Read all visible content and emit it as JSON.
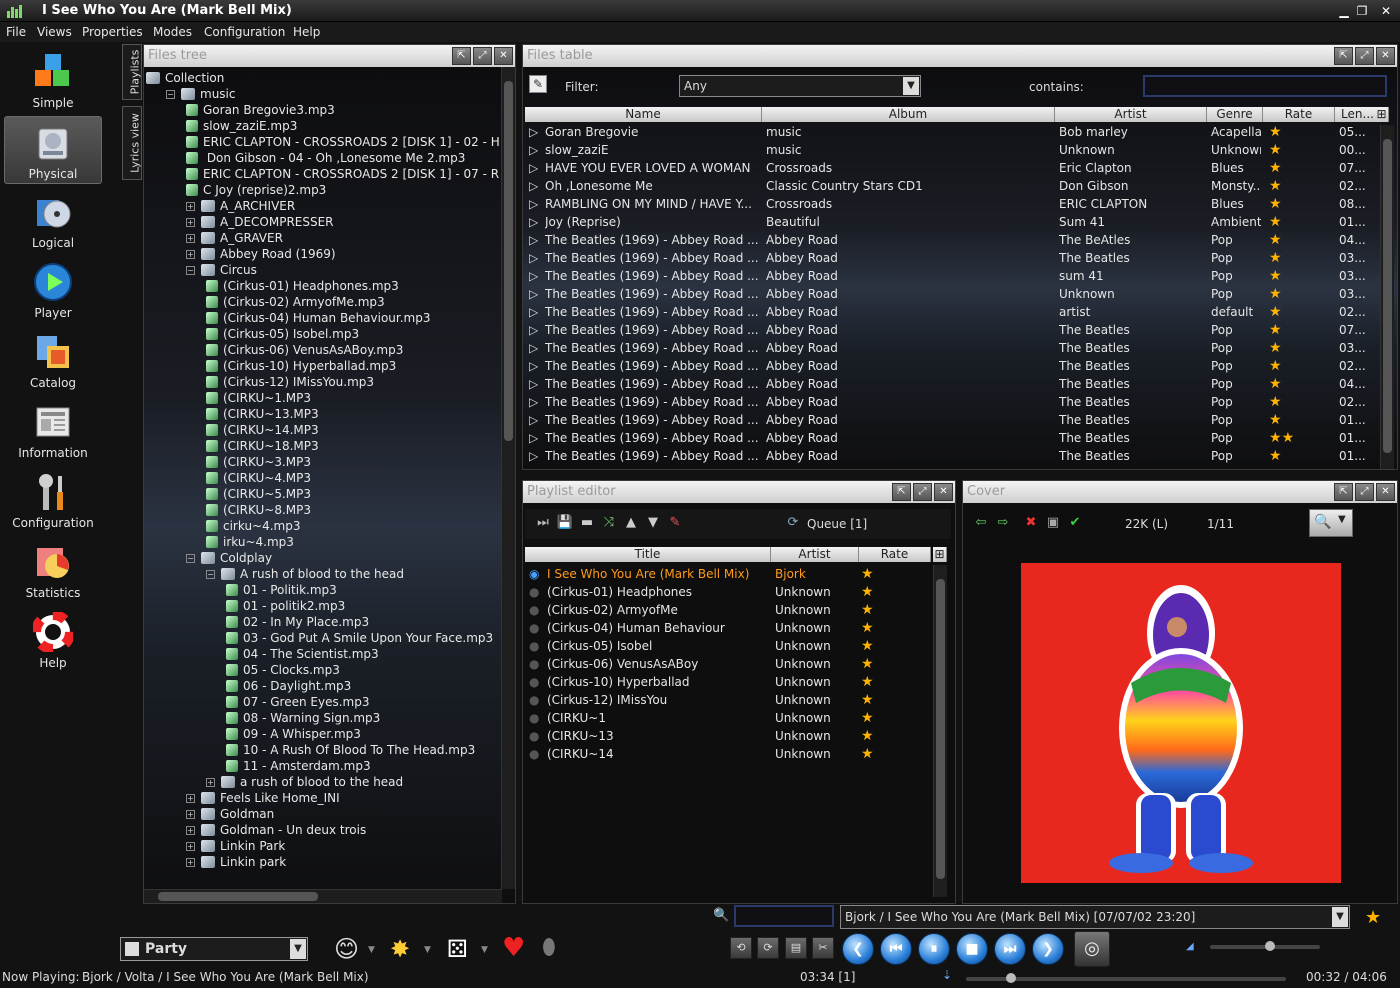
{
  "window": {
    "title": "I See Who You Are (Mark Bell Mix)"
  },
  "menu": [
    "File",
    "Views",
    "Properties",
    "Modes",
    "Configuration",
    "Help"
  ],
  "perspectives": [
    {
      "label": "Simple",
      "icon": "cubes-icon"
    },
    {
      "label": "Physical",
      "icon": "harddisk-icon",
      "selected": true
    },
    {
      "label": "Logical",
      "icon": "cd-icon"
    },
    {
      "label": "Player",
      "icon": "play-icon"
    },
    {
      "label": "Catalog",
      "icon": "catalog-icon"
    },
    {
      "label": "Information",
      "icon": "newspaper-icon"
    },
    {
      "label": "Configuration",
      "icon": "tools-icon"
    },
    {
      "label": "Statistics",
      "icon": "statistics-icon"
    },
    {
      "label": "Help",
      "icon": "lifebuoy-icon"
    }
  ],
  "side_tabs": [
    "Playlists",
    "Lyrics view"
  ],
  "files_tree": {
    "title": "Files tree",
    "items": [
      {
        "label": "Collection",
        "level": 0,
        "type": "root"
      },
      {
        "label": "music",
        "level": 1,
        "type": "folder",
        "expanded": true
      },
      {
        "label": "Goran Bregovie3.mp3",
        "level": 2,
        "type": "file"
      },
      {
        "label": "slow_zaziE.mp3",
        "level": 2,
        "type": "file"
      },
      {
        "label": "ERIC CLAPTON - CROSSROADS 2 [DISK 1] - 02 - H",
        "level": 2,
        "type": "file"
      },
      {
        "label": " Don Gibson - 04 - Oh ,Lonesome Me 2.mp3",
        "level": 2,
        "type": "file"
      },
      {
        "label": "ERIC CLAPTON - CROSSROADS 2 [DISK 1] - 07 - R",
        "level": 2,
        "type": "file"
      },
      {
        "label": "C Joy (reprise)2.mp3",
        "level": 2,
        "type": "file"
      },
      {
        "label": "A_ARCHIVER",
        "level": 2,
        "type": "folder"
      },
      {
        "label": "A_DECOMPRESSER",
        "level": 2,
        "type": "folder"
      },
      {
        "label": "A_GRAVER",
        "level": 2,
        "type": "folder"
      },
      {
        "label": "Abbey Road (1969)",
        "level": 2,
        "type": "folder",
        "collapsed": true
      },
      {
        "label": "Circus",
        "level": 2,
        "type": "folder",
        "expanded": true
      },
      {
        "label": "(Cirkus-01) Headphones.mp3",
        "level": 3,
        "type": "file"
      },
      {
        "label": "(Cirkus-02) ArmyofMe.mp3",
        "level": 3,
        "type": "file"
      },
      {
        "label": "(Cirkus-04) Human Behaviour.mp3",
        "level": 3,
        "type": "file"
      },
      {
        "label": "(Cirkus-05) Isobel.mp3",
        "level": 3,
        "type": "file"
      },
      {
        "label": "(Cirkus-06) VenusAsABoy.mp3",
        "level": 3,
        "type": "file"
      },
      {
        "label": "(Cirkus-10) Hyperballad.mp3",
        "level": 3,
        "type": "file"
      },
      {
        "label": "(Cirkus-12) IMissYou.mp3",
        "level": 3,
        "type": "file"
      },
      {
        "label": "(CIRKU~1.MP3",
        "level": 3,
        "type": "file"
      },
      {
        "label": "(CIRKU~13.MP3",
        "level": 3,
        "type": "file"
      },
      {
        "label": "(CIRKU~14.MP3",
        "level": 3,
        "type": "file"
      },
      {
        "label": "(CIRKU~18.MP3",
        "level": 3,
        "type": "file"
      },
      {
        "label": "(CIRKU~3.MP3",
        "level": 3,
        "type": "file"
      },
      {
        "label": "(CIRKU~4.MP3",
        "level": 3,
        "type": "file"
      },
      {
        "label": "(CIRKU~5.MP3",
        "level": 3,
        "type": "file"
      },
      {
        "label": "(CIRKU~8.MP3",
        "level": 3,
        "type": "file"
      },
      {
        "label": "cirku~4.mp3",
        "level": 3,
        "type": "file"
      },
      {
        "label": "irku~4.mp3",
        "level": 3,
        "type": "file"
      },
      {
        "label": "Coldplay",
        "level": 2,
        "type": "folder",
        "expanded": true
      },
      {
        "label": "A rush of blood to the head",
        "level": 3,
        "type": "folder",
        "expanded": true
      },
      {
        "label": "01 - Politik.mp3",
        "level": 4,
        "type": "file"
      },
      {
        "label": "01 - politik2.mp3",
        "level": 4,
        "type": "file"
      },
      {
        "label": "02 - In My Place.mp3",
        "level": 4,
        "type": "file"
      },
      {
        "label": "03 - God Put A Smile Upon Your Face.mp3",
        "level": 4,
        "type": "file"
      },
      {
        "label": "04 - The Scientist.mp3",
        "level": 4,
        "type": "file"
      },
      {
        "label": "05 - Clocks.mp3",
        "level": 4,
        "type": "file"
      },
      {
        "label": "06 - Daylight.mp3",
        "level": 4,
        "type": "file"
      },
      {
        "label": "07 - Green Eyes.mp3",
        "level": 4,
        "type": "file"
      },
      {
        "label": "08 - Warning Sign.mp3",
        "level": 4,
        "type": "file"
      },
      {
        "label": "09 - A Whisper.mp3",
        "level": 4,
        "type": "file"
      },
      {
        "label": "10 - A Rush Of Blood To The Head.mp3",
        "level": 4,
        "type": "file"
      },
      {
        "label": "11 - Amsterdam.mp3",
        "level": 4,
        "type": "file"
      },
      {
        "label": "a rush of blood to the head",
        "level": 3,
        "type": "folder",
        "collapsed": true
      },
      {
        "label": "Feels Like Home_INI",
        "level": 2,
        "type": "folder",
        "collapsed": true
      },
      {
        "label": "Goldman",
        "level": 2,
        "type": "folder",
        "collapsed": true
      },
      {
        "label": "Goldman - Un deux trois",
        "level": 2,
        "type": "folder",
        "collapsed": true
      },
      {
        "label": "Linkin Park",
        "level": 2,
        "type": "folder",
        "collapsed": true
      },
      {
        "label": "Linkin park",
        "level": 2,
        "type": "folder",
        "collapsed": true
      }
    ]
  },
  "files_table": {
    "title": "Files table",
    "filter_label": "Filter:",
    "filter_value": "Any",
    "contains_label": "contains:",
    "contains_value": "",
    "columns": [
      "Name",
      "Album",
      "Artist",
      "Genre",
      "Rate",
      "Len..."
    ],
    "rows": [
      [
        "Goran Bregovie",
        "music",
        "Bob marley",
        "Acapella",
        "1",
        "05..."
      ],
      [
        "slow_zaziE",
        "music",
        "Unknown",
        "Unknown",
        "1",
        "00..."
      ],
      [
        "HAVE YOU EVER LOVED A WOMAN",
        "Crossroads",
        "Eric Clapton",
        "Blues",
        "1",
        "07..."
      ],
      [
        "Oh ,Lonesome Me",
        "Classic Country Stars CD1",
        "Don Gibson",
        "Monsty...",
        "1",
        "02..."
      ],
      [
        "RAMBLING ON MY MIND / HAVE Y...",
        "Crossroads",
        "ERIC CLAPTON",
        "Blues",
        "1",
        "08..."
      ],
      [
        "Joy (Reprise)",
        "Beautiful",
        "Sum 41",
        "Ambient",
        "1",
        "01..."
      ],
      [
        "The Beatles (1969) - Abbey Road ...",
        "Abbey Road",
        "The BeAtles",
        "Pop",
        "1",
        "04..."
      ],
      [
        "The Beatles (1969) - Abbey Road ...",
        "Abbey Road",
        "The  Beatles",
        "Pop",
        "1",
        "03..."
      ],
      [
        "The Beatles (1969) - Abbey Road ...",
        "Abbey Road",
        "sum 41",
        "Pop",
        "1",
        "03..."
      ],
      [
        "The Beatles (1969) - Abbey Road ...",
        "Abbey Road",
        "Unknown",
        "Pop",
        "1",
        "03..."
      ],
      [
        "The Beatles (1969) - Abbey Road ...",
        "Abbey Road",
        "artist",
        "default",
        "1",
        "02..."
      ],
      [
        "The Beatles (1969) - Abbey Road ...",
        "Abbey Road",
        "The Beatles",
        "Pop",
        "1",
        "07..."
      ],
      [
        "The Beatles (1969) - Abbey Road ...",
        "Abbey Road",
        "The Beatles",
        "Pop",
        "1",
        "03..."
      ],
      [
        "The Beatles (1969) - Abbey Road ...",
        "Abbey Road",
        "The Beatles",
        "Pop",
        "1",
        "02..."
      ],
      [
        "The Beatles (1969) - Abbey Road ...",
        "Abbey Road",
        "The Beatles",
        "Pop",
        "1",
        "04..."
      ],
      [
        "The Beatles (1969) - Abbey Road ...",
        "Abbey Road",
        "The Beatles",
        "Pop",
        "1",
        "02..."
      ],
      [
        "The Beatles (1969) - Abbey Road ...",
        "Abbey Road",
        "The Beatles",
        "Pop",
        "1",
        "01..."
      ],
      [
        "The Beatles (1969) - Abbey Road ...",
        "Abbey Road",
        "The Beatles",
        "Pop",
        "2",
        "01..."
      ],
      [
        "The Beatles (1969) - Abbey Road ...",
        "Abbey Road",
        "The Beatles",
        "Pop",
        "1",
        "01..."
      ]
    ]
  },
  "playlist_editor": {
    "title": "Playlist editor",
    "queue_label": "Queue [1]",
    "columns": [
      "Title",
      "Artist",
      "Rate"
    ],
    "rows": [
      {
        "title": "I See Who You Are (Mark Bell Mix)",
        "artist": "Bjork",
        "rate": 1,
        "playing": true
      },
      {
        "title": "(Cirkus-01) Headphones",
        "artist": "Unknown",
        "rate": 1
      },
      {
        "title": "(Cirkus-02) ArmyofMe",
        "artist": "Unknown",
        "rate": 1
      },
      {
        "title": "(Cirkus-04) Human Behaviour",
        "artist": "Unknown",
        "rate": 1
      },
      {
        "title": "(Cirkus-05) Isobel",
        "artist": "Unknown",
        "rate": 1
      },
      {
        "title": "(Cirkus-06) VenusAsABoy",
        "artist": "Unknown",
        "rate": 1
      },
      {
        "title": "(Cirkus-10) Hyperballad",
        "artist": "Unknown",
        "rate": 1
      },
      {
        "title": "(Cirkus-12) IMissYou",
        "artist": "Unknown",
        "rate": 1
      },
      {
        "title": "(CIRKU~1",
        "artist": "Unknown",
        "rate": 1
      },
      {
        "title": "(CIRKU~13",
        "artist": "Unknown",
        "rate": 1
      },
      {
        "title": "(CIRKU~14",
        "artist": "Unknown",
        "rate": 1
      }
    ]
  },
  "cover": {
    "title": "Cover",
    "size_label": "22K (L)",
    "index_label": "1/11"
  },
  "bottom": {
    "ambience": "Party",
    "search_placeholder": "",
    "history_value": "Bjork / I See Who You Are (Mark Bell Mix) [07/07/02 23:20]",
    "elapsed_queue": "03:34 [1]",
    "time": "00:32 / 04:06",
    "now_playing_label": "Now Playing:",
    "now_playing": "Bjork / Volta / I See Who You Are (Mark Bell Mix)",
    "progress": 0.13,
    "volume": 0.55
  },
  "colors": {
    "accent": "#ffb300",
    "playing": "#ff9a1a",
    "cover_bg": "#e8281e"
  }
}
